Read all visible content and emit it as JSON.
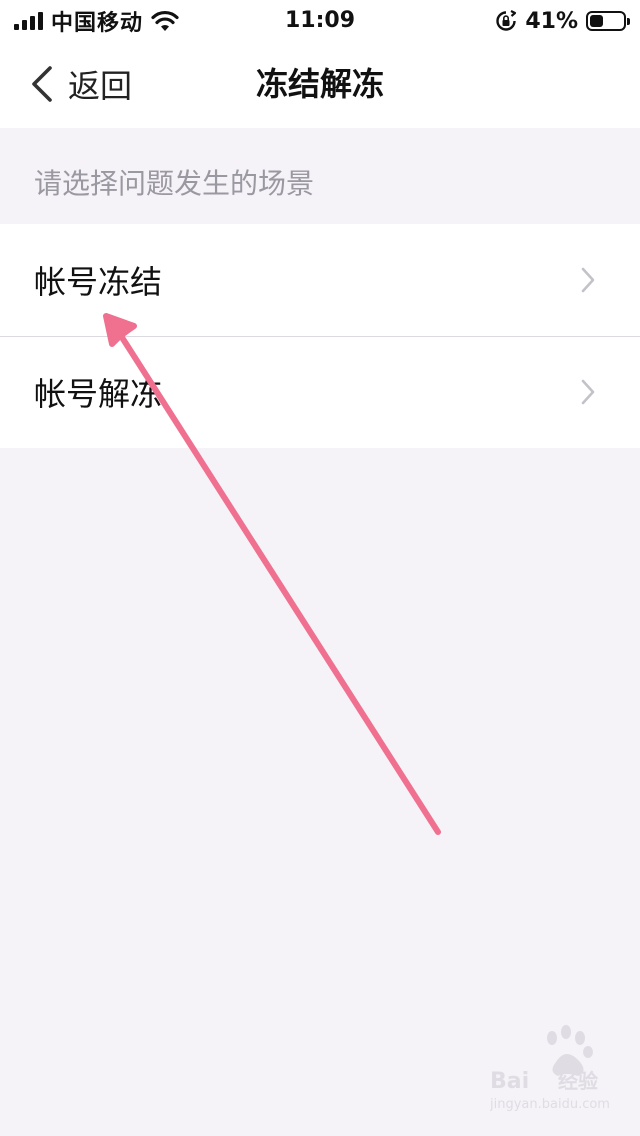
{
  "status_bar": {
    "carrier": "中国移动",
    "time": "11:09",
    "battery_percent": "41%",
    "battery_level": 0.41,
    "icons": [
      "signal-icon",
      "wifi-icon",
      "orientation-lock-icon",
      "battery-icon"
    ]
  },
  "nav": {
    "back_label": "返回",
    "title": "冻结解冻"
  },
  "section": {
    "header": "请选择问题发生的场景"
  },
  "list": {
    "items": [
      {
        "label": "帐号冻结"
      },
      {
        "label": "帐号解冻"
      }
    ]
  },
  "watermark": {
    "brand": "Bai",
    "brand_suffix": "经验",
    "domain": "jingyan.baidu.com"
  },
  "colors": {
    "background": "#f5f2f8",
    "annotation_arrow": "#f07090",
    "secondary_text": "#9a98a0",
    "chevron": "#c4c2c8"
  }
}
